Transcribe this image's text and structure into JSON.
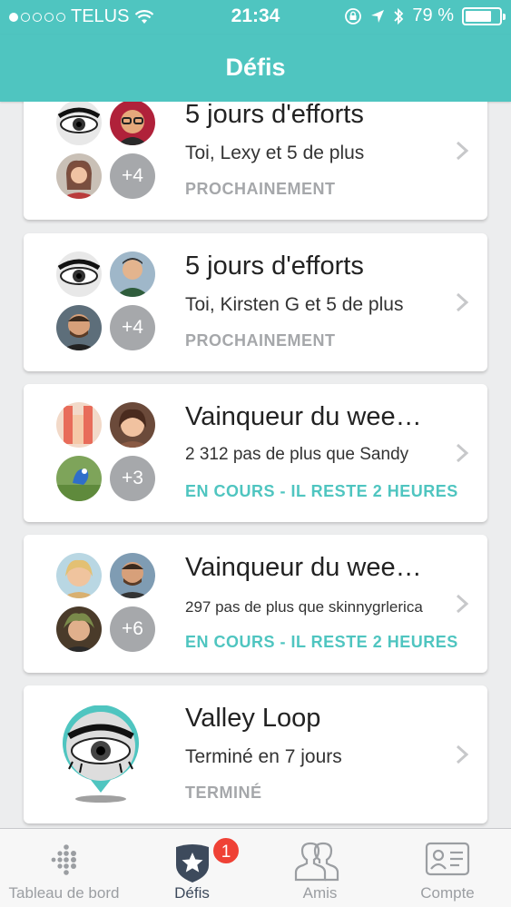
{
  "status_bar": {
    "carrier": "TELUS",
    "time": "21:34",
    "battery": "79 %",
    "battery_level": 0.79
  },
  "nav": {
    "title": "Défis"
  },
  "challenges": [
    {
      "name": "5 jours d'efforts",
      "subtitle": "Toi, Lexy et 5 de plus",
      "status": "PROCHAINEMENT",
      "status_type": "upcoming",
      "extra_count": "+4"
    },
    {
      "name": "5 jours d'efforts",
      "subtitle": "Toi, Kirsten G et 5 de plus",
      "status": "PROCHAINEMENT",
      "status_type": "upcoming",
      "extra_count": "+4"
    },
    {
      "name": "Vainqueur du wee…",
      "subtitle": "2 312 pas de plus que Sandy",
      "status": "EN COURS  - IL RESTE 2 HEURES",
      "status_type": "active",
      "extra_count": "+3"
    },
    {
      "name": "Vainqueur du wee…",
      "subtitle": "297 pas de plus que skinnygrlerica",
      "status": "EN COURS  - IL RESTE 2 HEURES",
      "status_type": "active",
      "extra_count": "+6"
    },
    {
      "name": "Valley Loop",
      "subtitle": "Terminé en 7 jours",
      "status": "TERMINÉ",
      "status_type": "done"
    }
  ],
  "tabs": [
    {
      "label": "Tableau de bord",
      "icon": "dashboard-dots-icon"
    },
    {
      "label": "Défis",
      "icon": "challenges-star-icon",
      "badge": "1"
    },
    {
      "label": "Amis",
      "icon": "friends-icon"
    },
    {
      "label": "Compte",
      "icon": "account-card-icon"
    }
  ],
  "colors": {
    "accent": "#4fc5c0",
    "status_gray": "#a5a7aa",
    "badge_red": "#ef4135"
  }
}
